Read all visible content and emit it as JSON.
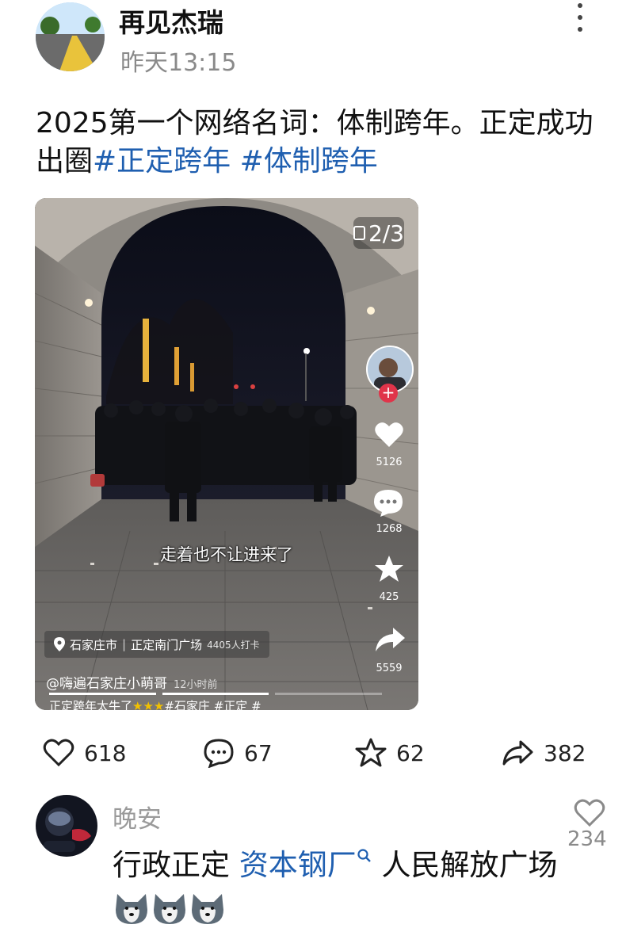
{
  "author": {
    "name": "再见杰瑞",
    "time": "昨天13:15"
  },
  "post": {
    "text": "2025第一个网络名词：体制跨年。正定成功出圈",
    "tags": [
      "#正定跨年",
      "#体制跨年"
    ]
  },
  "media": {
    "page_indicator": "2/3",
    "subtitle": "走着也不让进来了",
    "side_actions": {
      "like_count": "5126",
      "comment_count": "1268",
      "favorite_count": "425",
      "share_count": "5559"
    },
    "location": {
      "city": "石家庄市",
      "place": "正定南门广场",
      "checkins": "4405人打卡"
    },
    "uploader": "@嗨遍石家庄小萌哥",
    "uploaded_ago": "12小时前",
    "caption": "正定跨年太牛了",
    "caption_tags": [
      "#石家庄",
      "#正定",
      "#"
    ]
  },
  "actions": {
    "likes": "618",
    "comments": "67",
    "favorites": "62",
    "shares": "382"
  },
  "comment": {
    "author": "晚安",
    "likes": "234",
    "text_part1": "行政正定",
    "link": "资本钢厂",
    "text_part2": "人民解放广场"
  },
  "colors": {
    "link": "#1f5fb0",
    "secondary_text": "#8a8a8a"
  }
}
